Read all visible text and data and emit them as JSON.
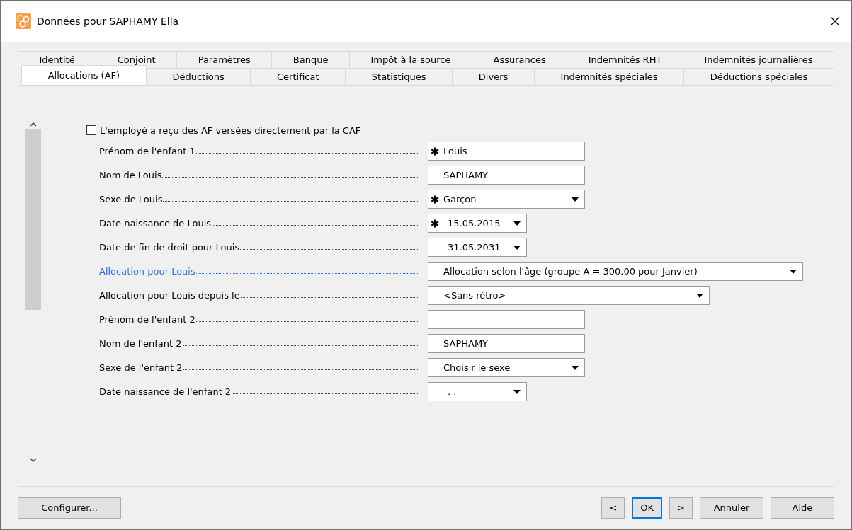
{
  "window": {
    "title": "Données pour SAPHAMY Ella"
  },
  "tab_rows": [
    {
      "tabs": [
        {
          "label": "Identité",
          "selected": false
        },
        {
          "label": "Conjoint",
          "selected": false
        },
        {
          "label": "Paramètres",
          "selected": false
        },
        {
          "label": "Banque",
          "selected": false
        },
        {
          "label": "Impôt à la source",
          "selected": false
        },
        {
          "label": "Assurances",
          "selected": false
        },
        {
          "label": "Indemnités RHT",
          "selected": false
        },
        {
          "label": "Indemnités journalières",
          "selected": false
        }
      ]
    },
    {
      "tabs": [
        {
          "label": "Allocations (AF)",
          "selected": true
        },
        {
          "label": "Déductions",
          "selected": false
        },
        {
          "label": "Certificat",
          "selected": false
        },
        {
          "label": "Statistiques",
          "selected": false
        },
        {
          "label": "Divers",
          "selected": false
        },
        {
          "label": "Indemnités spéciales",
          "selected": false
        },
        {
          "label": "Déductions spéciales",
          "selected": false
        }
      ]
    }
  ],
  "checkbox": {
    "label": "L'employé a reçu des AF versées directement par la CAF",
    "checked": false
  },
  "fields": [
    {
      "label": "Prénom de l'enfant 1",
      "kind": "text",
      "value": "Louis",
      "required": true,
      "highlighted": false
    },
    {
      "label": "Nom de Louis",
      "kind": "text",
      "value": "SAPHAMY",
      "required": false,
      "highlighted": false
    },
    {
      "label": "Sexe de Louis",
      "kind": "select",
      "value": "Garçon",
      "required": true,
      "highlighted": false
    },
    {
      "label": "Date naissance de Louis",
      "kind": "date",
      "value": "15.05.2015",
      "required": true,
      "highlighted": false
    },
    {
      "label": "Date de fin de droit pour Louis",
      "kind": "date",
      "value": "31.05.2031",
      "required": false,
      "highlighted": false
    },
    {
      "label": "Allocation pour Louis",
      "kind": "long-select",
      "value": "Allocation selon l'âge (groupe A = 300.00 pour Janvier)",
      "required": false,
      "highlighted": true
    },
    {
      "label": "Allocation pour Louis depuis le",
      "kind": "medium-select",
      "value": "<Sans rétro>",
      "required": false,
      "highlighted": false
    },
    {
      "label": "Prénom de l'enfant 2",
      "kind": "text",
      "required": false,
      "highlighted": false
    },
    {
      "label": "Nom de l'enfant 2",
      "kind": "text",
      "value": "SAPHAMY",
      "required": false,
      "highlighted": false
    },
    {
      "label": "Sexe de l'enfant 2",
      "kind": "select",
      "value": "Choisir le sexe",
      "required": false,
      "highlighted": false
    },
    {
      "label": "Date naissance de l'enfant 2",
      "kind": "date",
      "value": ". .",
      "required": false,
      "highlighted": false
    }
  ],
  "left_buttons": [
    {
      "label": "Configurer...",
      "default": false
    }
  ],
  "right_buttons": [
    {
      "label": "<",
      "default": false
    },
    {
      "label": "OK",
      "default": true
    },
    {
      "label": ">",
      "default": false
    },
    {
      "label": "Annuler",
      "default": false
    },
    {
      "label": "Aide",
      "default": false
    }
  ]
}
